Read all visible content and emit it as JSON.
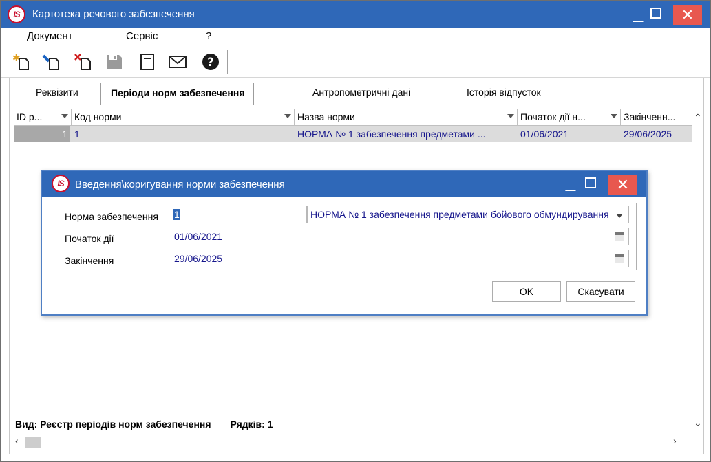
{
  "window": {
    "title": "Картотека речового забезпечення"
  },
  "menu": {
    "items": [
      "Документ",
      "Сервіс",
      "?"
    ]
  },
  "toolbar": {
    "icons": [
      "new-document-icon",
      "edit-document-icon",
      "delete-document-icon",
      "save-icon",
      "form-icon",
      "mail-icon",
      "help-icon"
    ]
  },
  "tabs": [
    "Реквізити",
    "Періоди норм забезпечення",
    "Антропометричні дані",
    "Історія відпусток"
  ],
  "active_tab": 1,
  "grid": {
    "headers": [
      "ID р...",
      "Код норми",
      "Назва норми",
      "Початок дії н...",
      "Закінченн..."
    ],
    "rows": [
      [
        "1",
        "1",
        "НОРМА № 1 забезпечення предметами ...",
        "01/06/2021",
        "29/06/2025"
      ]
    ]
  },
  "status": {
    "view": "Вид: Реєстр періодів норм забезпечення",
    "rows": "Рядків: 1"
  },
  "dialog": {
    "title": "Введення\\коригування норми забезпечення",
    "fields": {
      "norm_label": "Норма забезпечення",
      "norm_code": "1",
      "norm_name": "НОРМА № 1 забезпечення предметами бойового обмундирування",
      "start_label": "Початок дії",
      "start_value": "01/06/2021",
      "end_label": "Закінчення",
      "end_value": "29/06/2025"
    },
    "ok_label": "OK",
    "cancel_label": "Скасувати"
  },
  "colors": {
    "titlebar": "#2f68b8",
    "close_button": "#e8584f",
    "value_text": "#16168c",
    "selected_row": "#dcdcdc"
  }
}
